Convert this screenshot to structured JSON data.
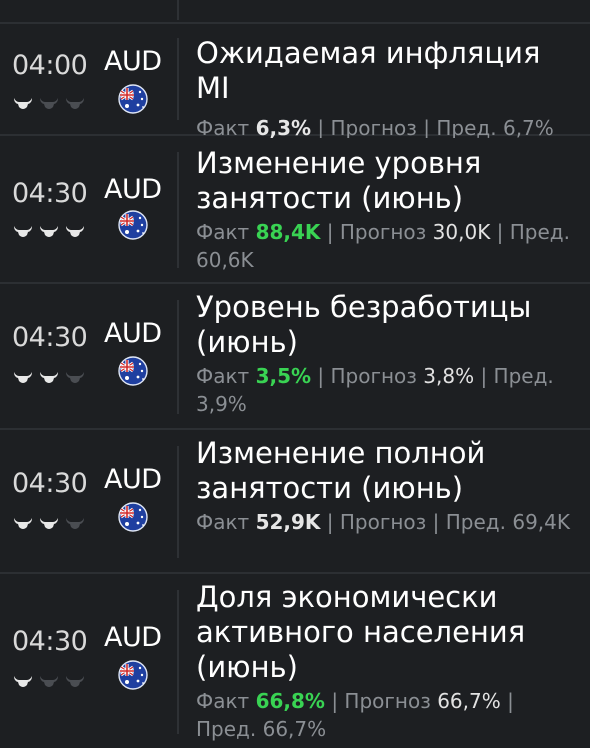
{
  "events": [
    {
      "time": "04:00",
      "currency": "AUD",
      "importance": 1,
      "title": "Ожидаемая инфляция MI",
      "labels": {
        "actual": "Факт",
        "forecast": "| Прогноз",
        "previous": "| Пред."
      },
      "actual": "6,3%",
      "actual_trend": "neutral",
      "forecast": "",
      "previous": "6,7%"
    },
    {
      "time": "04:30",
      "currency": "AUD",
      "importance": 3,
      "title": "Изменение уровня занятости (июнь)",
      "labels": {
        "actual": "Факт",
        "forecast": "| Прогноз",
        "previous": "| Пред."
      },
      "actual": "88,4K",
      "actual_trend": "up",
      "forecast": "30,0K",
      "previous": "60,6K"
    },
    {
      "time": "04:30",
      "currency": "AUD",
      "importance": 2,
      "title": "Уровень безработицы (июнь)",
      "labels": {
        "actual": "Факт",
        "forecast": "| Прогноз",
        "previous": "| Пред."
      },
      "actual": "3,5%",
      "actual_trend": "up",
      "forecast": "3,8%",
      "previous": "3,9%"
    },
    {
      "time": "04:30",
      "currency": "AUD",
      "importance": 2,
      "title": "Изменение полной занятости (июнь)",
      "labels": {
        "actual": "Факт",
        "forecast": "| Прогноз",
        "previous": "| Пред."
      },
      "actual": "52,9K",
      "actual_trend": "neutral",
      "forecast": "",
      "previous": "69,4K"
    },
    {
      "time": "04:30",
      "currency": "AUD",
      "importance": 1,
      "title": "Доля экономически активного населения (июнь)",
      "labels": {
        "actual": "Факт",
        "forecast": "| Прогноз",
        "previous": "| Пред."
      },
      "actual": "66,8%",
      "actual_trend": "up",
      "forecast": "66,7%",
      "previous": "66,7%"
    }
  ],
  "colors": {
    "active_bull": "#e8e8e8",
    "inactive_bull": "#4a4d52",
    "positive": "#39d353"
  },
  "icons": {
    "importance": "bull-icon",
    "flag": "australia-flag-icon"
  }
}
